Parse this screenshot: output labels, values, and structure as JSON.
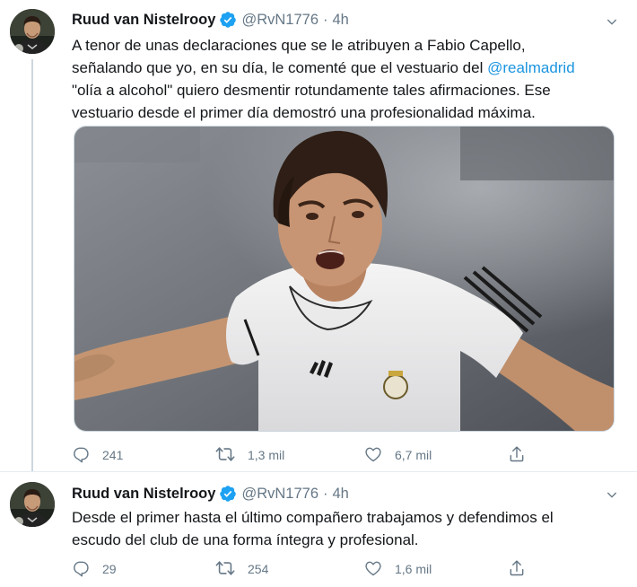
{
  "tweets": [
    {
      "name": "Ruud van Nistelrooy",
      "handle": "@RvN1776",
      "dot": "·",
      "time": "4h",
      "lines": [
        [
          "A tenor  de unas declaraciones que se le atribuyen a Fabio Capello,"
        ],
        [
          "señalando que yo, en su día, le comenté que el vestuario del ",
          "@realmadrid"
        ],
        [
          "\"olía a alcohol\"  quiero desmentir rotundamente tales afirmaciones. Ese"
        ],
        [
          "vestuario desde el primer día demostró una profesionalidad máxima."
        ]
      ],
      "line1": "A tenor  de unas declaraciones que se le atribuyen a Fabio Capello,",
      "line2_prefix": "señalando que yo, en su día, le comenté que el vestuario del ",
      "line2_mention": "@realmadrid",
      "line3": "\"olía a alcohol\"  quiero desmentir rotundamente tales afirmaciones. Ese",
      "line4": "vestuario desde el primer día demostró una profesionalidad máxima.",
      "replies": "241",
      "retweets": "1,3 mil",
      "likes": "6,7 mil"
    },
    {
      "name": "Ruud van Nistelrooy",
      "handle": "@RvN1776",
      "dot": "·",
      "time": "4h",
      "line1": "Desde el primer hasta el último compañero trabajamos y defendimos el",
      "line2": "escudo del club de una forma íntegra y profesional.",
      "replies": "29",
      "retweets": "254",
      "likes": "1,6 mil"
    }
  ],
  "icons": {
    "verified": "verified-badge-icon",
    "caret": "chevron-down-icon",
    "reply": "reply-icon",
    "retweet": "retweet-icon",
    "like": "heart-icon",
    "share": "share-icon"
  },
  "colors": {
    "accent": "#1b95e0",
    "verified": "#1da1f2",
    "secondary_text": "#657786",
    "border": "#ccd6dd"
  }
}
